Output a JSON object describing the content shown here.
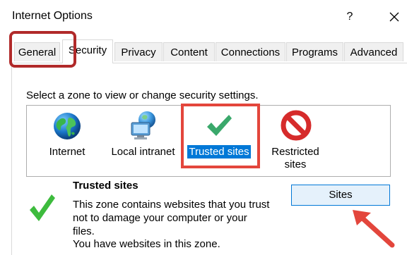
{
  "window": {
    "title": "Internet Options",
    "help_label": "?"
  },
  "tabs": [
    {
      "label": "General"
    },
    {
      "label": "Security"
    },
    {
      "label": "Privacy"
    },
    {
      "label": "Content"
    },
    {
      "label": "Connections"
    },
    {
      "label": "Programs"
    },
    {
      "label": "Advanced"
    }
  ],
  "active_tab": "Security",
  "security": {
    "zone_prompt": "Select a zone to view or change security settings.",
    "zones": [
      {
        "label": "Internet",
        "icon": "globe-icon"
      },
      {
        "label": "Local intranet",
        "icon": "intranet-icon"
      },
      {
        "label": "Trusted sites",
        "icon": "checkmark-icon",
        "selected": true
      },
      {
        "label": "Restricted",
        "label2": "sites",
        "icon": "prohibited-icon"
      }
    ],
    "selected_zone": {
      "title": "Trusted sites",
      "description": "This zone contains websites that you trust not to damage your computer or your files.",
      "status": "You have websites in this zone.",
      "icon": "checkmark-icon"
    },
    "sites_button": "Sites"
  },
  "colors": {
    "annotation_dark_red": "#b12a2a",
    "annotation_red": "#e3463c",
    "selection_blue": "#0078d7",
    "check_green": "#2bb673"
  }
}
